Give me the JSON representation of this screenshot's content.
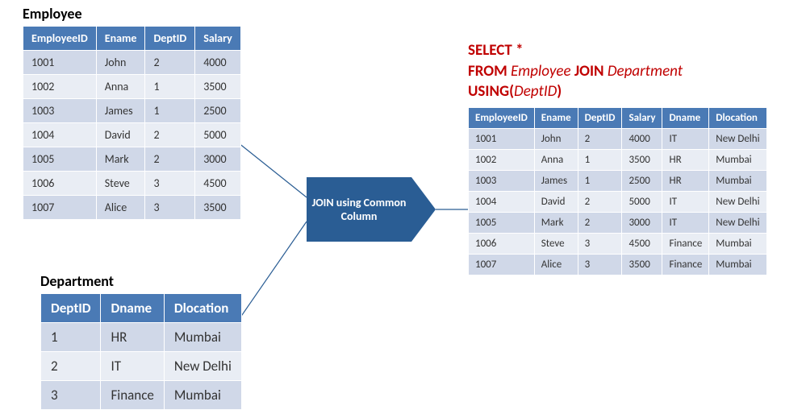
{
  "employee": {
    "title": "Employee",
    "columns": [
      "EmployeeID",
      "Ename",
      "DeptID",
      "Salary"
    ],
    "rows": [
      [
        "1001",
        "John",
        "2",
        "4000"
      ],
      [
        "1002",
        "Anna",
        "1",
        "3500"
      ],
      [
        "1003",
        "James",
        "1",
        "2500"
      ],
      [
        "1004",
        "David",
        "2",
        "5000"
      ],
      [
        "1005",
        "Mark",
        "2",
        "3000"
      ],
      [
        "1006",
        "Steve",
        "3",
        "4500"
      ],
      [
        "1007",
        "Alice",
        "3",
        "3500"
      ]
    ]
  },
  "department": {
    "title": "Department",
    "columns": [
      "DeptID",
      "Dname",
      "Dlocation"
    ],
    "rows": [
      [
        "1",
        "HR",
        "Mumbai"
      ],
      [
        "2",
        "IT",
        "New Delhi"
      ],
      [
        "3",
        "Finance",
        "Mumbai"
      ]
    ]
  },
  "sql": {
    "line1_kw1": "SELECT ",
    "line1_rest": "*",
    "line2_kw1": "FROM ",
    "line2_em1": "Employee ",
    "line2_kw2": "JOIN ",
    "line2_em2": "Department",
    "line3_kw1": "USING(",
    "line3_em1": "DeptID",
    "line3_kw2": ")"
  },
  "result": {
    "columns": [
      "EmployeeID",
      "Ename",
      "DeptID",
      "Salary",
      "Dname",
      "Dlocation"
    ],
    "rows": [
      [
        "1001",
        "John",
        "2",
        "4000",
        "IT",
        "New Delhi"
      ],
      [
        "1002",
        "Anna",
        "1",
        "3500",
        "HR",
        "Mumbai"
      ],
      [
        "1003",
        "James",
        "1",
        "2500",
        "HR",
        "Mumbai"
      ],
      [
        "1004",
        "David",
        "2",
        "5000",
        "IT",
        "New Delhi"
      ],
      [
        "1005",
        "Mark",
        "2",
        "3000",
        "IT",
        "New Delhi"
      ],
      [
        "1006",
        "Steve",
        "3",
        "4500",
        "Finance",
        "Mumbai"
      ],
      [
        "1007",
        "Alice",
        "3",
        "3500",
        "Finance",
        "Mumbai"
      ]
    ]
  },
  "join_label": "JOIN using Common Column"
}
